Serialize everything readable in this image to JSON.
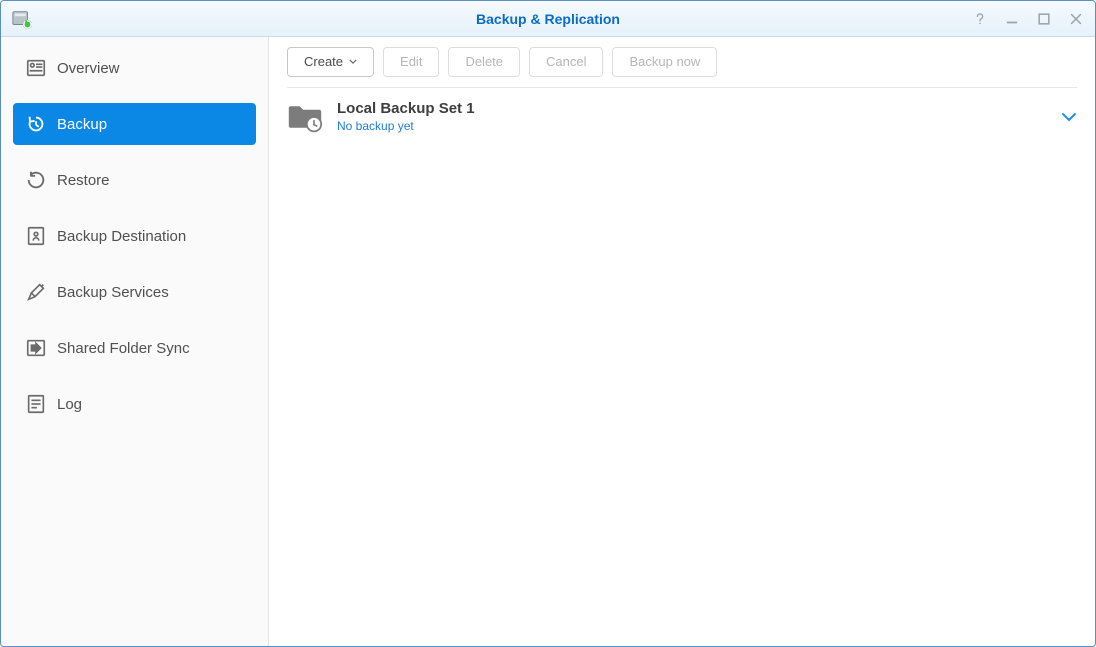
{
  "window": {
    "title": "Backup & Replication"
  },
  "sidebar": {
    "items": [
      {
        "label": "Overview"
      },
      {
        "label": "Backup"
      },
      {
        "label": "Restore"
      },
      {
        "label": "Backup Destination"
      },
      {
        "label": "Backup Services"
      },
      {
        "label": "Shared Folder Sync"
      },
      {
        "label": "Log"
      }
    ]
  },
  "toolbar": {
    "create": "Create",
    "edit": "Edit",
    "delete": "Delete",
    "cancel": "Cancel",
    "backup_now": "Backup now"
  },
  "tasks": [
    {
      "title": "Local Backup Set 1",
      "status": "No backup yet"
    }
  ]
}
